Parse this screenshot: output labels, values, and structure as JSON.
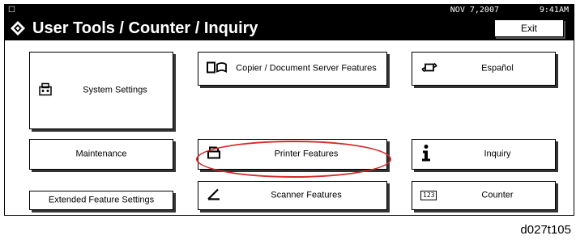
{
  "status_bar": {
    "date": "NOV  7,2007",
    "time": "9:41AM",
    "left_icon": "small-status-icon"
  },
  "header": {
    "title": "User Tools / Counter / Inquiry",
    "icon": "user-tools-icon",
    "exit_label": "Exit"
  },
  "buttons": {
    "system_settings": {
      "label": "System Settings",
      "icon": "system-settings-icon"
    },
    "maintenance": {
      "label": "Maintenance"
    },
    "extended_feature_settings": {
      "label": "Extended Feature Settings"
    },
    "copier_document_server": {
      "label": "Copier / Document Server Features",
      "icon": "copier-icon"
    },
    "printer_features": {
      "label": "Printer Features",
      "icon": "printer-icon"
    },
    "scanner_features": {
      "label": "Scanner Features",
      "icon": "scanner-icon"
    },
    "espanol": {
      "label": "Español",
      "icon": "language-icon"
    },
    "inquiry": {
      "label": "Inquiry",
      "icon": "info-icon"
    },
    "counter": {
      "label": "Counter",
      "icon": "counter-icon",
      "icon_text": "123"
    }
  },
  "highlight_color": "#d42a2a",
  "caption": "d027t105"
}
